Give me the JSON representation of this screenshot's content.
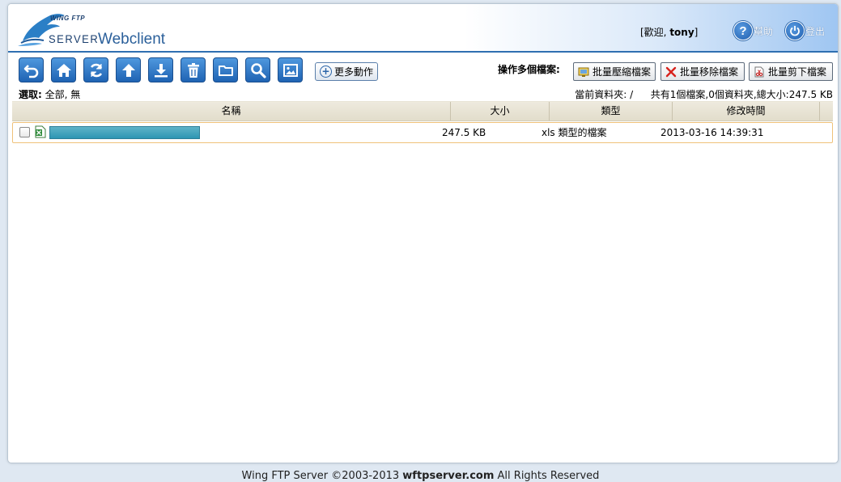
{
  "header": {
    "logo_top": "WING FTP",
    "logo_server": "SERVER",
    "logo_webclient": "Webclient",
    "welcome_prefix": "[歡迎, ",
    "username": "tony",
    "welcome_suffix": "]",
    "help_label": "幫助",
    "logout_label": "登出"
  },
  "toolbar": {
    "buttons": [
      {
        "name": "back",
        "icon": "undo-arrow-icon"
      },
      {
        "name": "home",
        "icon": "home-icon"
      },
      {
        "name": "refresh",
        "icon": "refresh-icon"
      },
      {
        "name": "upload",
        "icon": "upload-arrow-icon"
      },
      {
        "name": "download",
        "icon": "download-icon"
      },
      {
        "name": "delete",
        "icon": "trash-icon"
      },
      {
        "name": "new-folder",
        "icon": "folder-icon"
      },
      {
        "name": "search",
        "icon": "search-icon"
      },
      {
        "name": "thumbnail",
        "icon": "image-icon"
      }
    ],
    "more_label": "更多動作",
    "multi_label": "操作多個檔案:",
    "batch_zip": "批量壓縮檔案",
    "batch_delete": "批量移除檔案",
    "batch_cut": "批量剪下檔案"
  },
  "selection": {
    "label": "選取:",
    "all": "全部",
    "none": "無"
  },
  "status": {
    "current_folder_label": "當前資料夾:",
    "current_folder": "/",
    "summary": "共有1個檔案,0個資料夾,總大小:247.5 KB"
  },
  "table": {
    "columns": [
      "名稱",
      "大小",
      "類型",
      "修改時間"
    ],
    "rows": [
      {
        "name": "",
        "size": "247.5 KB",
        "type": "xls 類型的檔案",
        "modified": "2013-03-16 14:39:31"
      }
    ]
  },
  "footer": {
    "prefix": "Wing FTP Server ©2003-2013 ",
    "site": "wftpserver.com",
    "suffix": " All Rights Reserved"
  },
  "colors": {
    "accent": "#2f6fb1",
    "toolbar_button": "#2a72c4",
    "row_border": "#efc27a",
    "header_bg": "#e6e2d3"
  }
}
